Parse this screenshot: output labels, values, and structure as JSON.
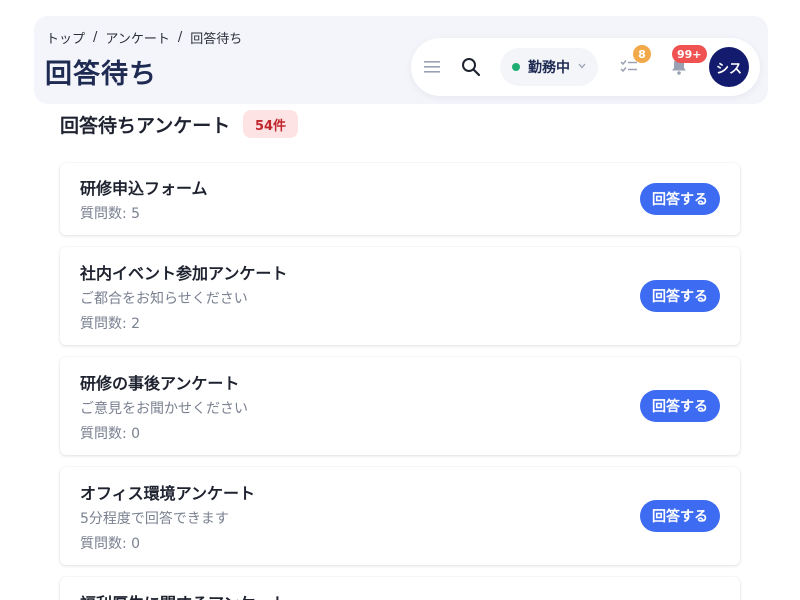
{
  "breadcrumb": {
    "items": [
      "トップ",
      "アンケート",
      "回答待ち"
    ],
    "separator": "/"
  },
  "page_title": "回答待ち",
  "toolbar": {
    "status_label": "勤務中",
    "tasks_badge": "8",
    "notifications_badge": "99+",
    "avatar_text": "シス",
    "icons": [
      "menu-icon",
      "search-icon",
      "tasks-icon",
      "bell-icon",
      "chevron-down-icon"
    ]
  },
  "section": {
    "title": "回答待ちアンケート",
    "count": "54件"
  },
  "surveys": [
    {
      "title": "研修申込フォーム",
      "description": "",
      "meta": "質問数: 5",
      "button": "回答する"
    },
    {
      "title": "社内イベント参加アンケート",
      "description": "ご都合をお知らせください",
      "meta": "質問数: 2",
      "button": "回答する"
    },
    {
      "title": "研修の事後アンケート",
      "description": "ご意見をお聞かせください",
      "meta": "質問数: 0",
      "button": "回答する"
    },
    {
      "title": "オフィス環境アンケート",
      "description": "5分程度で回答できます",
      "meta": "質問数: 0",
      "button": "回答する"
    },
    {
      "title": "福利厚生に関するアンケート",
      "description": "",
      "meta": "",
      "button": ""
    }
  ],
  "colors": {
    "accent": "#3d6cf2",
    "status_online": "#1fae72",
    "badge_warning": "#f2a94a",
    "badge_danger": "#f05252",
    "avatar_bg": "#131b6e"
  }
}
